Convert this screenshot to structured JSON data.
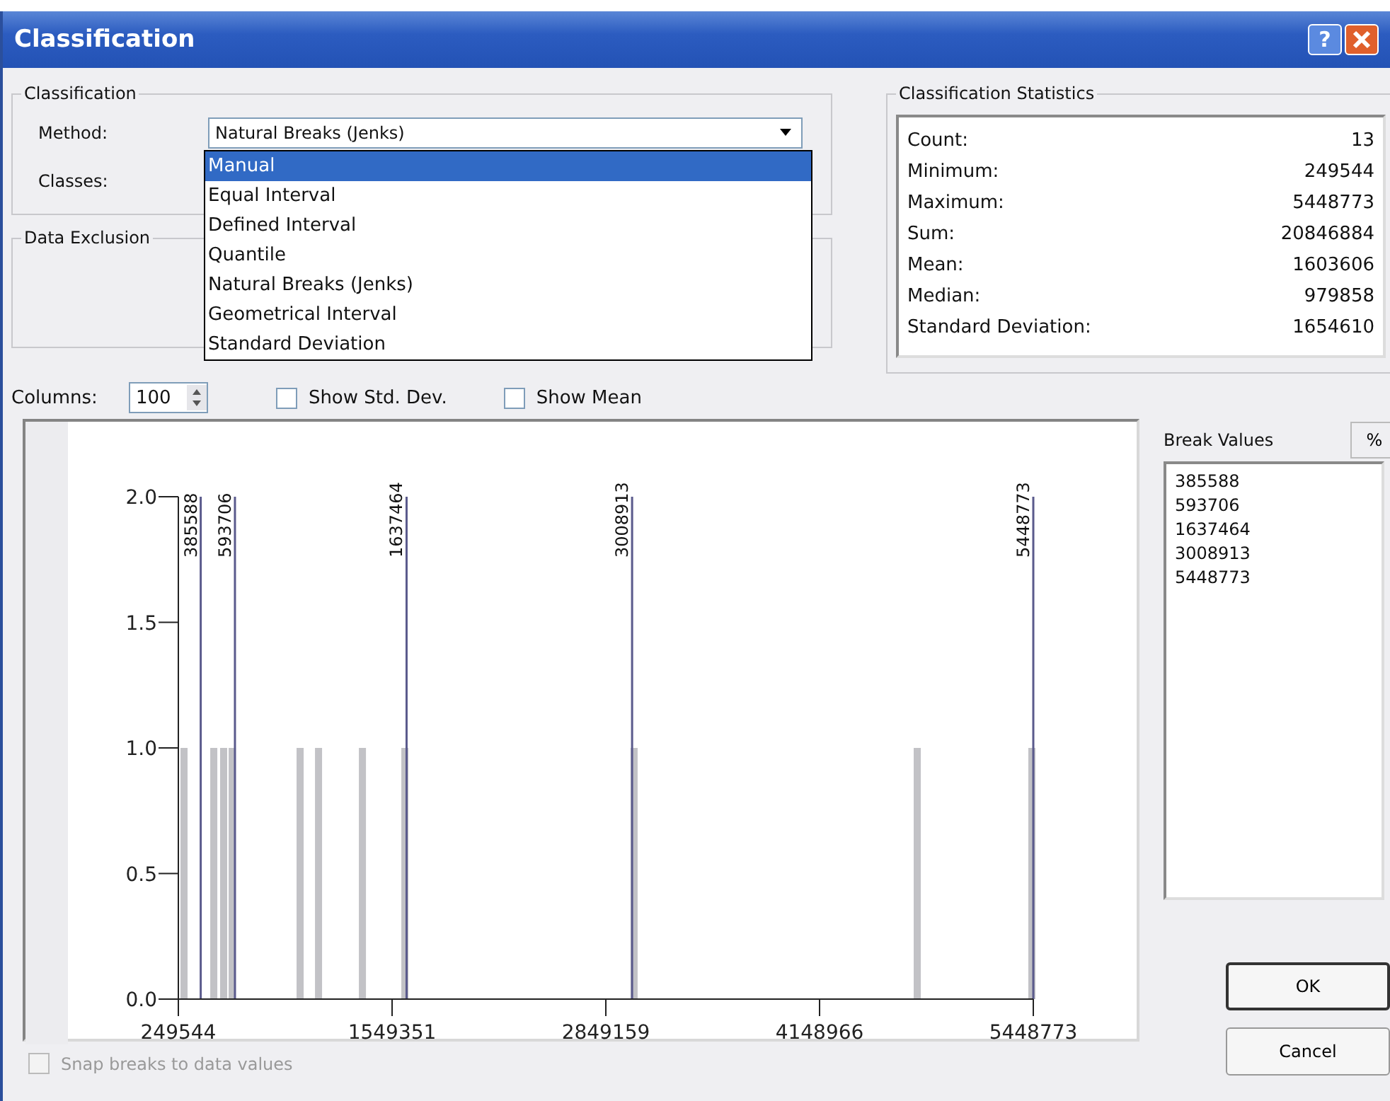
{
  "window": {
    "title": "Classification",
    "help_label": "?"
  },
  "classification": {
    "title": "Classification",
    "method_label": "Method:",
    "method_value": "Natural Breaks (Jenks)",
    "classes_label": "Classes:"
  },
  "method_dropdown": [
    {
      "label": "Manual",
      "selected": true
    },
    {
      "label": "Equal Interval",
      "selected": false
    },
    {
      "label": "Defined Interval",
      "selected": false
    },
    {
      "label": "Quantile",
      "selected": false
    },
    {
      "label": "Natural Breaks (Jenks)",
      "selected": false
    },
    {
      "label": "Geometrical Interval",
      "selected": false
    },
    {
      "label": "Standard Deviation",
      "selected": false
    }
  ],
  "data_exclusion": {
    "title": "Data Exclusion"
  },
  "statistics": {
    "title": "Classification Statistics",
    "rows": [
      {
        "label": "Count:",
        "value": "13"
      },
      {
        "label": "Minimum:",
        "value": "249544"
      },
      {
        "label": "Maximum:",
        "value": "5448773"
      },
      {
        "label": "Sum:",
        "value": "20846884"
      },
      {
        "label": "Mean:",
        "value": "1603606"
      },
      {
        "label": "Median:",
        "value": "979858"
      },
      {
        "label": "Standard Deviation:",
        "value": "1654610"
      }
    ]
  },
  "columns": {
    "label": "Columns:",
    "value": "100"
  },
  "options": [
    {
      "label": "Show Std. Dev.",
      "checked": false
    },
    {
      "label": "Show Mean",
      "checked": false
    }
  ],
  "histogram": {
    "chart_data": {
      "type": "bar",
      "x": [
        284000,
        465000,
        525000,
        577000,
        990000,
        1102000,
        1369000,
        1627000,
        3021000,
        4743000,
        5440000
      ],
      "values": [
        1,
        1,
        1,
        1,
        1,
        1,
        1,
        1,
        1,
        1,
        1
      ],
      "xlim": [
        249544,
        5448773
      ],
      "ylim": [
        0,
        2
      ],
      "xticks": [
        249544,
        1549351,
        2849159,
        4148966,
        5448773
      ],
      "yticks": [
        {
          "value": 0,
          "label": "0.0"
        },
        {
          "value": 0.5,
          "label": "0.5"
        },
        {
          "value": 1,
          "label": "1.0"
        },
        {
          "value": 1.5,
          "label": "1.5"
        },
        {
          "value": 2,
          "label": "2.0"
        }
      ],
      "ref_lines": [
        {
          "axis": "x",
          "value": 385588,
          "label": "385588"
        },
        {
          "axis": "x",
          "value": 593706,
          "label": "593706"
        },
        {
          "axis": "x",
          "value": 1637464,
          "label": "1637464"
        },
        {
          "axis": "x",
          "value": 3008913,
          "label": "3008913"
        },
        {
          "axis": "x",
          "value": 5448773,
          "label": "5448773"
        }
      ]
    }
  },
  "break_values": {
    "title": "Break Values",
    "percent_label": "%",
    "values": [
      "385588",
      "593706",
      "1637464",
      "3008913",
      "5448773"
    ]
  },
  "snap": {
    "label": "Snap breaks to data values",
    "checked": false,
    "disabled": true
  },
  "buttons": [
    "OK",
    "Cancel"
  ]
}
